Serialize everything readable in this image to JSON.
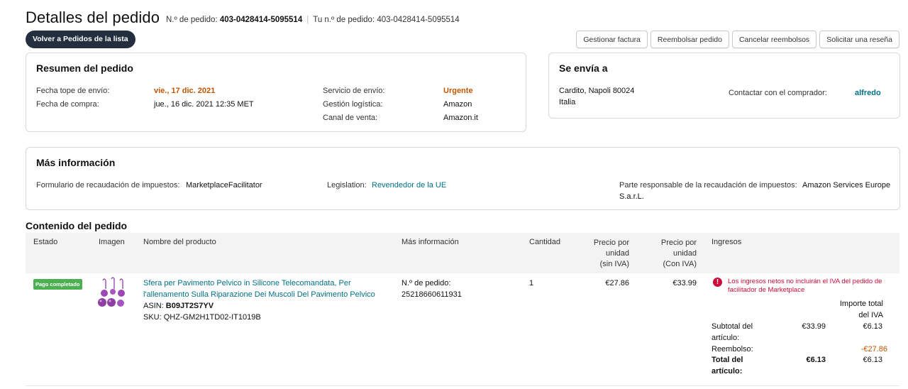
{
  "header": {
    "title": "Detalles del pedido",
    "order_no_label": "N.º de pedido:",
    "order_no_value": "403-0428414-5095514",
    "your_order_no_label": "Tu n.º de pedido:",
    "your_order_no_value": "403-0428414-5095514",
    "back_button": "Volver a Pedidos de la lista",
    "actions": [
      "Gestionar factura",
      "Reembolsar pedido",
      "Cancelar reembolsos",
      "Solicitar una reseña"
    ]
  },
  "summary": {
    "title": "Resumen del pedido",
    "ship_by_label": "Fecha tope de envío:",
    "ship_by_value": "vie., 17 dic. 2021",
    "purchase_date_label": "Fecha de compra:",
    "purchase_date_value": "jue., 16 dic. 2021 12:35 MET",
    "shipping_service_label": "Servicio de envío:",
    "shipping_service_value": "Urgente",
    "fulfillment_label": "Gestión logística:",
    "fulfillment_value": "Amazon",
    "sales_channel_label": "Canal de venta:",
    "sales_channel_value": "Amazon.it"
  },
  "ship_to": {
    "title": "Se envía a",
    "address_line1": "Cardito, Napoli 80024",
    "address_line2": "Italia",
    "contact_label": "Contactar con el comprador:",
    "buyer_name": "alfredo"
  },
  "more_info": {
    "title": "Más información",
    "tax_form_label": "Formulario de recaudación de impuestos:",
    "tax_form_value": "MarketplaceFacilitator",
    "legislation_label": "Legislation:",
    "legislation_value": "Revendedor de la UE",
    "responsible_label": "Parte responsable de la recaudación de impuestos:",
    "responsible_value_1": "Amazon Services Europe",
    "responsible_value_2": "S.a.r.L."
  },
  "contents": {
    "title": "Contenido del pedido",
    "columns": {
      "status": "Estado",
      "image": "Imagen",
      "product_name": "Nombre del producto",
      "more_info": "Más información",
      "quantity": "Cantidad",
      "unit_price_no_vat_1": "Precio por",
      "unit_price_no_vat_2": "unidad",
      "unit_price_no_vat_3": "(sin IVA)",
      "unit_price_vat_1": "Precio por",
      "unit_price_vat_2": "unidad",
      "unit_price_vat_3": "(Con IVA)",
      "income": "Ingresos"
    },
    "item": {
      "status_badge": "Pago completado",
      "product_title_1": "Sfera per Pavimento Pelvico in Silicone Telecomandata, Per",
      "product_title_2": "l'allenamento Sulla Riparazione Dei Muscoli Del Pavimento Pelvico",
      "asin_label": "ASIN:",
      "asin_value": "B09JT2S7YV",
      "sku": "SKU: QHZ-GM2H1TD02-IT1019B",
      "order_item_label": "N.º de pedido:",
      "order_item_value": "25218660611931",
      "quantity": "1",
      "unit_price_no_vat": "€27.86",
      "unit_price_vat": "€33.99",
      "warning_line1": "Los ingresos netos no incluirán el IVA del pedido de",
      "warning_line2": "facilitador de Marketplace",
      "total_import_label_1": "Importe total",
      "total_import_label_2": "del IVA",
      "subtotal_label_1": "Subtotal del",
      "subtotal_label_2": "artículo:",
      "subtotal_value": "€33.99",
      "subtotal_vat": "€6.13",
      "refund_label": "Reembolso:",
      "refund_vat": "-€27.86",
      "total_label_1": "Total del",
      "total_label_2": "artículo:",
      "total_value": "€6.13",
      "total_vat": "€6.13"
    }
  },
  "colors": {
    "accent_link": "#007185",
    "orange": "#c45500",
    "badge_green": "#4caf50",
    "warning_red": "#cc0c39",
    "dark_button": "#232f3e",
    "product_purple": "#8e3fa3"
  }
}
